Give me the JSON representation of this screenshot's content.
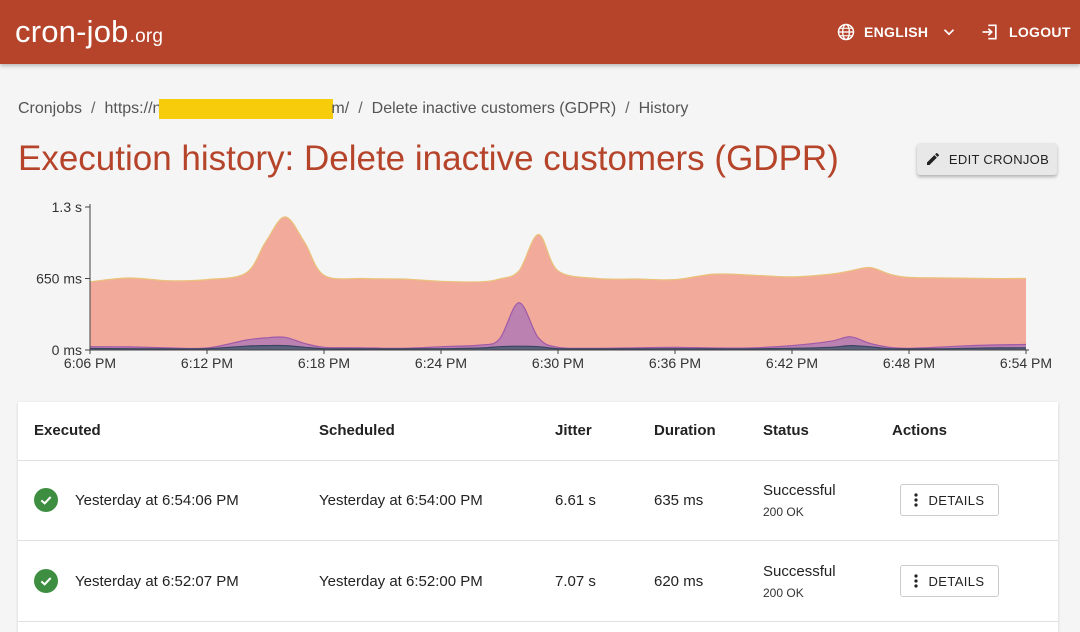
{
  "header": {
    "logo_main": "cron-job",
    "logo_tld": ".org",
    "language_label": "ENGLISH",
    "logout_label": "LOGOUT"
  },
  "breadcrumb": {
    "items": [
      "Cronjobs",
      "https://",
      "n",
      "m/",
      "Delete inactive customers (GDPR)",
      "History"
    ],
    "separator": "/"
  },
  "page": {
    "title": "Execution history: Delete inactive customers (GDPR)",
    "edit_button_label": "EDIT CRONJOB"
  },
  "chart_data": {
    "type": "area",
    "title": "",
    "xlabel": "",
    "ylabel": "",
    "x": [
      "6:06 PM",
      "6:12 PM",
      "6:18 PM",
      "6:24 PM",
      "6:30 PM",
      "6:36 PM",
      "6:42 PM",
      "6:48 PM",
      "6:54 PM"
    ],
    "y_ticks": [
      "0 ms",
      "650 ms",
      "1.3 s"
    ],
    "ylim_ms": [
      0,
      1300
    ],
    "x_minutes": [
      0,
      2,
      4,
      6,
      8,
      9,
      10,
      11,
      12,
      14,
      16,
      18,
      20,
      21,
      22,
      23,
      24,
      26,
      28,
      30,
      32,
      34,
      36,
      38,
      39,
      40,
      41,
      42,
      44,
      46,
      48
    ],
    "series": [
      {
        "color": "#f2aa9b",
        "stroke": "#eac27a",
        "values": [
          620,
          655,
          630,
          640,
          700,
          980,
          1210,
          980,
          680,
          650,
          645,
          625,
          620,
          645,
          720,
          1050,
          720,
          650,
          645,
          640,
          690,
          680,
          665,
          690,
          720,
          750,
          690,
          660,
          655,
          650,
          650
        ]
      },
      {
        "color": "#b07ab5",
        "stroke": "#a05aa8",
        "values": [
          30,
          28,
          20,
          18,
          90,
          110,
          115,
          60,
          25,
          20,
          15,
          30,
          45,
          100,
          430,
          110,
          25,
          15,
          20,
          25,
          18,
          20,
          40,
          80,
          120,
          60,
          25,
          15,
          30,
          45,
          50
        ]
      },
      {
        "color": "#4b5a77",
        "stroke": "#3a4560",
        "values": [
          14,
          12,
          10,
          12,
          35,
          40,
          40,
          25,
          12,
          10,
          10,
          12,
          18,
          30,
          35,
          30,
          12,
          10,
          10,
          12,
          10,
          10,
          15,
          25,
          40,
          28,
          12,
          10,
          12,
          18,
          20
        ]
      }
    ],
    "grid": false,
    "legend": "none"
  },
  "table": {
    "headers": {
      "executed": "Executed",
      "scheduled": "Scheduled",
      "jitter": "Jitter",
      "duration": "Duration",
      "status": "Status",
      "actions": "Actions"
    },
    "rows": [
      {
        "executed": "Yesterday at 6:54:06 PM",
        "scheduled": "Yesterday at 6:54:00 PM",
        "jitter": "6.61 s",
        "duration": "635 ms",
        "status": "Successful",
        "status_code": "200 OK",
        "action_label": "DETAILS"
      },
      {
        "executed": "Yesterday at 6:52:07 PM",
        "scheduled": "Yesterday at 6:52:00 PM",
        "jitter": "7.07 s",
        "duration": "620 ms",
        "status": "Successful",
        "status_code": "200 OK",
        "action_label": "DETAILS"
      }
    ]
  },
  "colors": {
    "brand": "#b5442a",
    "success": "#3e8e41",
    "redaction": "#f6cc0b"
  },
  "icons": {
    "language": "globe-icon",
    "language_dropdown": "chevron-down-icon",
    "logout": "logout-icon",
    "edit": "pencil-icon",
    "status": "check-circle-icon",
    "menu": "more-vert-icon"
  }
}
